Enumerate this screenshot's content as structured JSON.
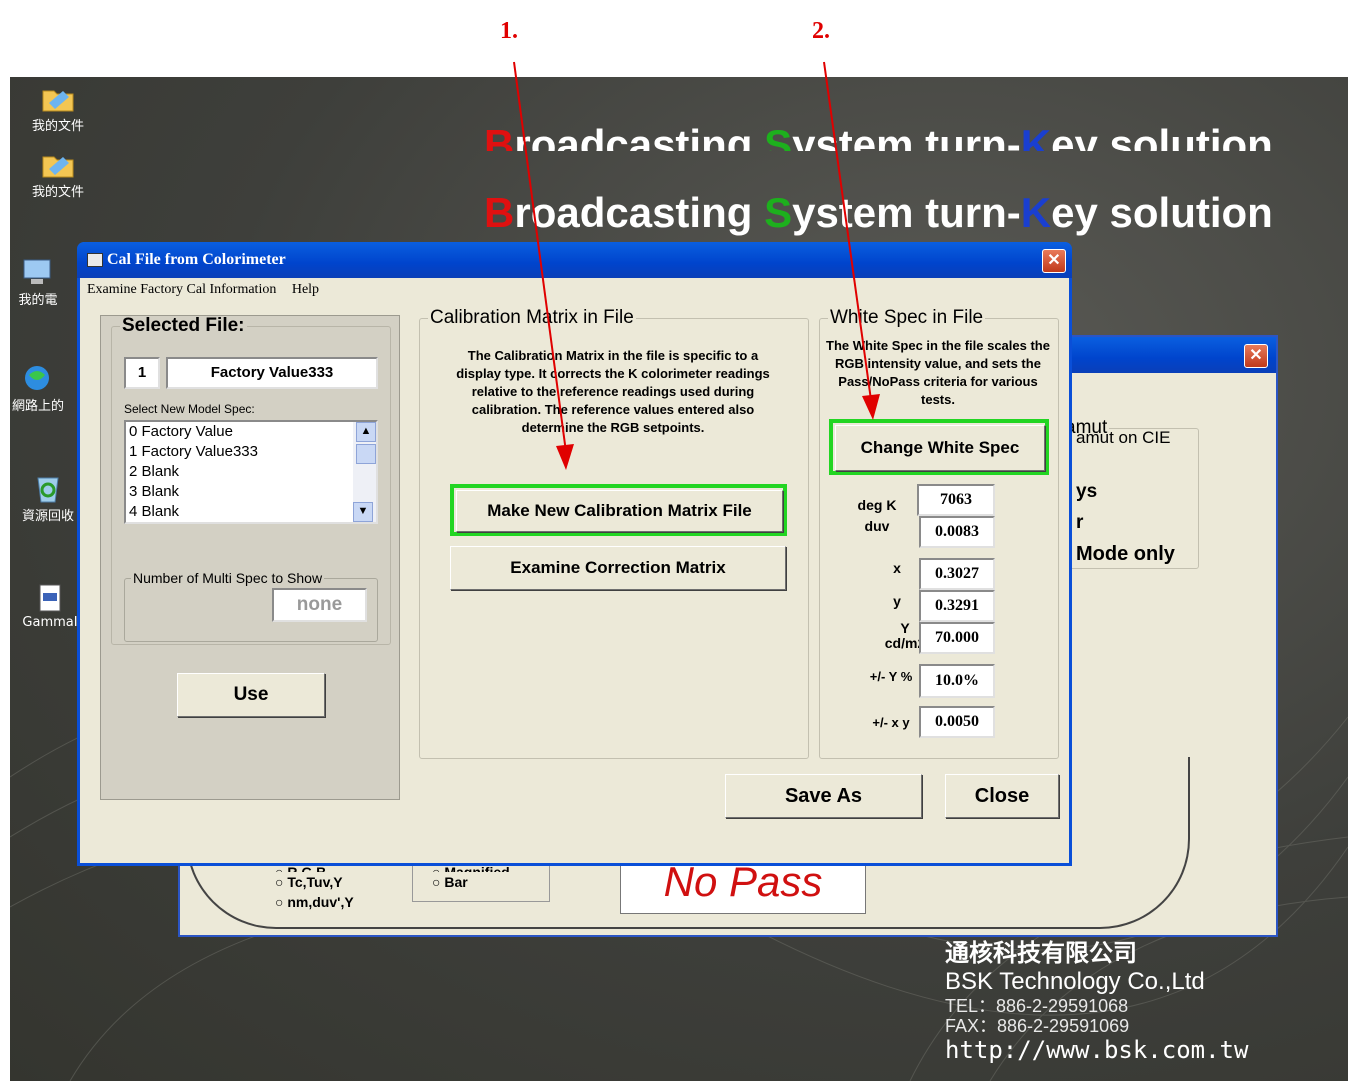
{
  "annotations": {
    "step1": "1.",
    "step2": "2.",
    "arrow_color": "#e00000"
  },
  "desktop": {
    "icons": [
      {
        "label": "我的文件",
        "icon": "folder-icon"
      },
      {
        "label": "我的文件",
        "icon": "folder-icon"
      },
      {
        "label": "我的電",
        "icon": "computer-icon"
      },
      {
        "label": "網路上的",
        "icon": "network-icon"
      },
      {
        "label": "資源回收",
        "icon": "recycle-bin-icon"
      },
      {
        "label": "GammaI",
        "icon": "program-icon"
      }
    ],
    "banner": {
      "p1": "B",
      "p2": "roadcasting ",
      "p3": "S",
      "p4": "ystem turn-",
      "p5": "K",
      "p6": "ey solution"
    },
    "company": {
      "cn": "通核科技有限公司",
      "en": "BSK Technology Co.,Ltd",
      "tel": "TEL：886-2-29591068",
      "fax": "FAX：886-2-29591069",
      "url": "http://www.bsk.com.tw"
    }
  },
  "background_window": {
    "group_label": "amut",
    "item1": "amut on CIE",
    "item2": "ys",
    "item3": "r",
    "item4": "Mode only",
    "radio1": "R,G,B",
    "radio2": "Tc,Tuv,Y",
    "radio3": "nm,duv',Y",
    "radio4": "Magnified",
    "radio5": "Bar",
    "status": "No Pass"
  },
  "dialog": {
    "title": "Cal File from Colorimeter",
    "menu": [
      "Examine Factory Cal Information",
      "Help"
    ],
    "selected_file": {
      "legend": "Selected File:",
      "number": "1",
      "name": "Factory Value333",
      "select_label": "Select New Model Spec:",
      "items": [
        "0  Factory Value",
        "1  Factory Value333",
        "2  Blank",
        "3  Blank",
        "4  Blank"
      ],
      "multi_label": "Number of Multi Spec to Show",
      "multi_value": "none",
      "use_button": "Use"
    },
    "calibration": {
      "legend": "Calibration Matrix in File",
      "description": "The Calibration Matrix in the file is specific to a display type. It corrects the K colorimeter readings relative to the reference readings used during calibration. The reference values entered also determine the RGB setpoints.",
      "make_button": "Make New Calibration Matrix File",
      "examine_button": "Examine Correction Matrix"
    },
    "white_spec": {
      "legend": "White Spec in File",
      "description": "The White Spec in the file scales the RGB intensity value, and sets the Pass/NoPass criteria for various tests.",
      "change_button": "Change White Spec",
      "degk_label": "deg K",
      "degk": "7063",
      "duv_label": "duv",
      "duv": "0.0083",
      "x_label": "x",
      "x": "0.3027",
      "y_label": "y",
      "y": "0.3291",
      "Y_label": "Y",
      "Y_unit": "cd/m2",
      "Y": "70.000",
      "tolY_label": "+/- Y %",
      "tolY": "10.0%",
      "tolxy_label": "+/- x y",
      "tolxy": "0.0050"
    },
    "save_as": "Save As",
    "close": "Close"
  }
}
